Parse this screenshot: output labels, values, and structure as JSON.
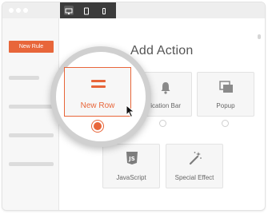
{
  "sidebar": {
    "new_rule_label": "New Rule"
  },
  "main": {
    "title": "Add Action"
  },
  "cards": {
    "new_row": "New Row",
    "notification_bar": "tification Bar",
    "popup": "Popup",
    "javascript": "JavaScript",
    "special_effect": "Special Effect"
  },
  "colors": {
    "accent": "#e8663a",
    "toolbar": "#3b3b3b"
  },
  "icons": [
    "desktop-icon",
    "tablet-icon",
    "mobile-icon",
    "bell-icon",
    "popup-icon",
    "js-icon",
    "magic-wand-icon",
    "cursor-icon"
  ]
}
